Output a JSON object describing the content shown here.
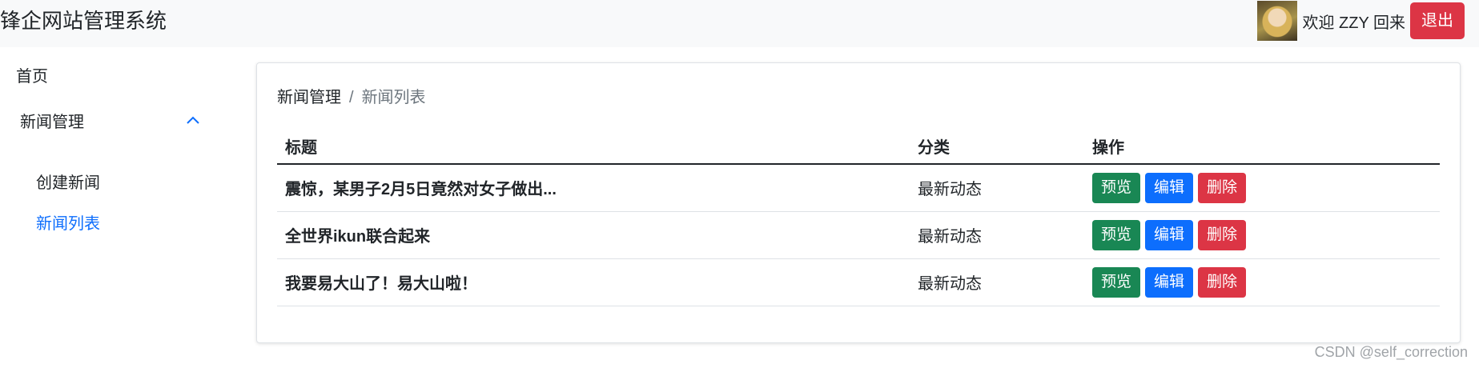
{
  "header": {
    "app_title": "锋企网站管理系统",
    "welcome_text": "欢迎 ZZY 回来",
    "logout_label": "退出",
    "avatar_icon": "user-avatar"
  },
  "sidebar": {
    "home_label": "首页",
    "group_label": "新闻管理",
    "group_expanded": true,
    "chevron_icon": "chevron-up-icon",
    "sub_items": [
      {
        "label": "创建新闻",
        "active": false
      },
      {
        "label": "新闻列表",
        "active": true
      }
    ]
  },
  "main": {
    "breadcrumb": {
      "parent": "新闻管理",
      "separator": "/",
      "current": "新闻列表"
    },
    "table": {
      "headers": [
        "标题",
        "分类",
        "操作"
      ],
      "rows": [
        {
          "title": "震惊，某男子2月5日竟然对女子做出...",
          "category": "最新动态"
        },
        {
          "title": "全世界ikun联合起来",
          "category": "最新动态"
        },
        {
          "title": "我要易大山了！易大山啦！",
          "category": "最新动态"
        }
      ],
      "actions": {
        "preview": "预览",
        "edit": "编辑",
        "delete": "删除"
      }
    }
  },
  "watermark": "CSDN @self_correction",
  "colors": {
    "primary": "#0d6efd",
    "success": "#198754",
    "danger": "#dc3545",
    "header_bg": "#f8f9fa"
  }
}
